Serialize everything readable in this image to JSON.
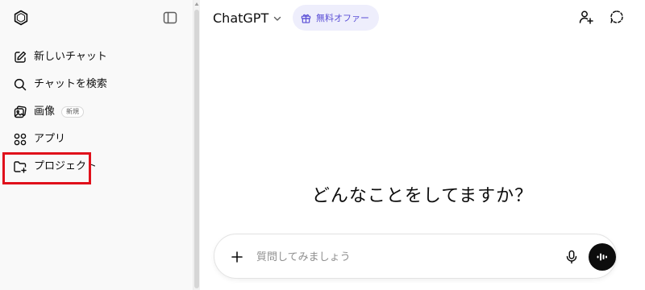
{
  "sidebar": {
    "logo_icon": "chatgpt-logo-icon",
    "toggle_icon": "sidebar-toggle-icon",
    "items": [
      {
        "label": "新しいチャット",
        "icon": "compose-icon"
      },
      {
        "label": "チャットを検索",
        "icon": "search-icon"
      },
      {
        "label": "画像",
        "icon": "images-icon",
        "badge": "新規"
      },
      {
        "label": "アプリ",
        "icon": "apps-grid-icon"
      },
      {
        "label": "プロジェクト",
        "icon": "folder-plus-icon",
        "highlighted": true
      }
    ]
  },
  "header": {
    "model_name": "ChatGPT",
    "offer_label": "無料オファー",
    "offer_icon": "gift-icon",
    "add_person_icon": "add-person-icon",
    "temp_chat_icon": "temporary-chat-icon"
  },
  "main": {
    "headline": "どんなことをしてますか？"
  },
  "composer": {
    "placeholder": "質問してみましょう",
    "value": "",
    "plus_icon": "plus-icon",
    "mic_icon": "microphone-icon",
    "voice_icon": "voice-mode-icon"
  },
  "colors": {
    "sidebar_bg": "#f9f9f9",
    "offer_bg": "#eeeefc",
    "offer_text": "#5b4fd6",
    "highlight": "#e0101b",
    "voice_button": "#0d0d0d"
  }
}
